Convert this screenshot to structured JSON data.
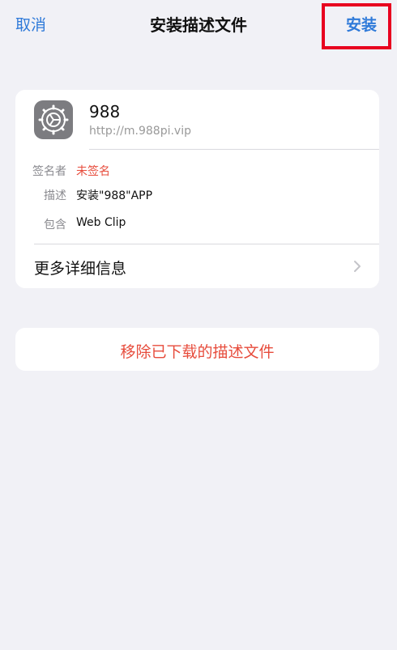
{
  "nav": {
    "cancel_label": "取消",
    "title": "安装描述文件",
    "install_label": "安装"
  },
  "profile": {
    "icon": "settings-gear-icon",
    "name": "988",
    "url": "http://m.988pi.vip",
    "details": [
      {
        "label": "签名者",
        "value": "未签名",
        "color": "#e74c3c"
      },
      {
        "label": "描述",
        "value": "安装\"988\"APP"
      },
      {
        "label": "包含",
        "value": "Web Clip"
      }
    ],
    "more_label": "更多详细信息"
  },
  "remove": {
    "label": "移除已下载的描述文件"
  },
  "colors": {
    "accent": "#2f7ad9",
    "danger": "#e74c3c",
    "highlight_box": "#e8001f",
    "background": "#f1f1f6"
  }
}
